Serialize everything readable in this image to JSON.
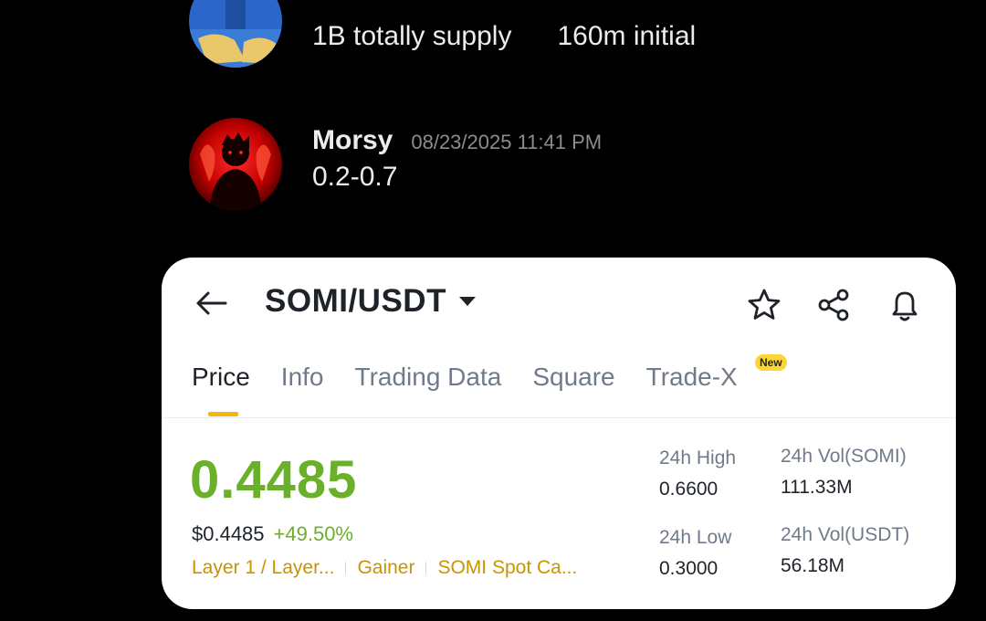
{
  "chat": {
    "messages": [
      {
        "username": "",
        "timestamp": "",
        "text_parts": [
          "1B totally supply",
          "160m initial"
        ]
      },
      {
        "username": "Morsy",
        "timestamp": "08/23/2025 11:41 PM",
        "text": "0.2-0.7"
      }
    ]
  },
  "card": {
    "pair": "SOMI/USDT",
    "tabs": [
      {
        "label": "Price"
      },
      {
        "label": "Info"
      },
      {
        "label": "Trading Data"
      },
      {
        "label": "Square"
      },
      {
        "label": "Trade-X"
      }
    ],
    "new_badge": "New",
    "price": "0.4485",
    "fiat_price": "$0.4485",
    "change": "+49.50%",
    "tags": [
      "Layer 1 / Layer...",
      "Gainer",
      "SOMI Spot Ca..."
    ],
    "stats": {
      "high_label": "24h High",
      "high_value": "0.6600",
      "low_label": "24h Low",
      "low_value": "0.3000",
      "vol_somi_label": "24h Vol(SOMI)",
      "vol_somi_value": "111.33M",
      "vol_usdt_label": "24h Vol(USDT)",
      "vol_usdt_value": "56.18M"
    },
    "colors": {
      "up": "#6bb02a",
      "accent": "#f0b90b",
      "tag": "#c99400"
    }
  }
}
